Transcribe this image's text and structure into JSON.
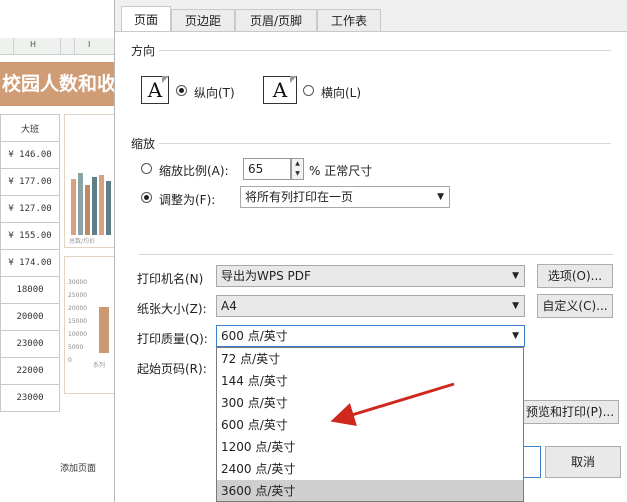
{
  "sheet": {
    "column_headers": [
      "H",
      "I"
    ],
    "title": "校园人数和收",
    "col_header": "大班",
    "rows": [
      "¥ 146.00",
      "¥ 177.00",
      "¥ 127.00",
      "¥ 155.00",
      "¥ 174.00",
      "18000",
      "20000",
      "23000",
      "22000",
      "23000"
    ],
    "chart1_caption": "总数/均价",
    "chart2_ticks": [
      "30000",
      "25000",
      "20000",
      "15000",
      "10000",
      "5000",
      "0"
    ],
    "chart2_caption": "系列",
    "add_page": "添加页面"
  },
  "dialog": {
    "tabs": [
      "页面",
      "页边距",
      "页眉/页脚",
      "工作表"
    ],
    "active_tab": 0,
    "orientation": {
      "section_title": "方向",
      "portrait_label": "纵向(T)",
      "landscape_label": "横向(L)",
      "icon_glyph": "A",
      "selected": "portrait"
    },
    "scaling": {
      "section_title": "缩放",
      "scale_label": "缩放比例(A):",
      "scale_value": "65",
      "scale_suffix": "% 正常尺寸",
      "fit_label": "调整为(F):",
      "fit_value": "将所有列打印在一页",
      "selected": "fit"
    },
    "printer_label": "打印机名(N)",
    "printer_value": "导出为WPS PDF",
    "options_button": "选项(O)...",
    "paper_label": "纸张大小(Z):",
    "paper_value": "A4",
    "custom_button": "自定义(C)...",
    "quality_label": "打印质量(Q):",
    "quality_value": "600 点/英寸",
    "start_page_label": "起始页码(R):",
    "quality_options": [
      "72 点/英寸",
      "144 点/英寸",
      "300 点/英寸",
      "600 点/英寸",
      "1200 点/英寸",
      "2400 点/英寸",
      "3600 点/英寸"
    ],
    "hovered_option": 6,
    "preview_print_button": "预览和打印(P)...",
    "cancel_button": "取消"
  },
  "colors": {
    "title_bg": "#cf9c75",
    "annotation_arrow": "#d0281e",
    "bar_colors": [
      "#d9a27c",
      "#8aa3a9",
      "#bd8a66",
      "#5f7f88"
    ]
  }
}
